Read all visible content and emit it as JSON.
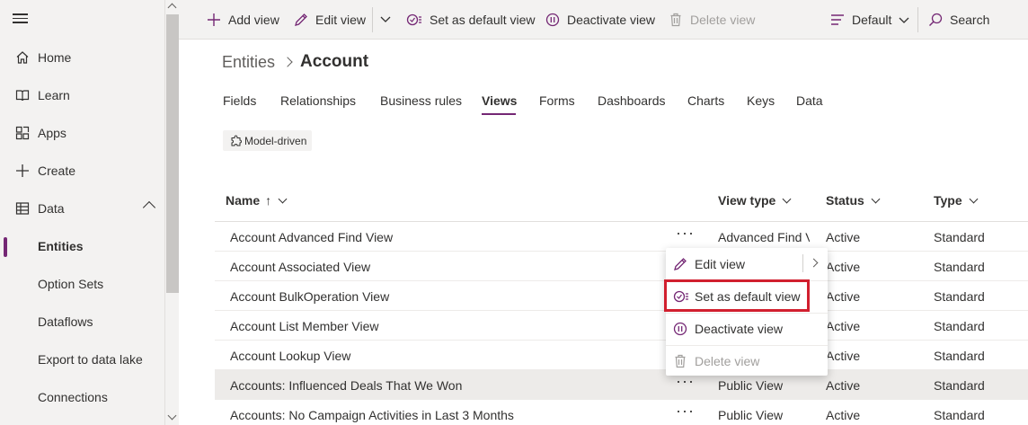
{
  "sidebar": {
    "items": [
      {
        "label": "Home",
        "icon": "home-icon"
      },
      {
        "label": "Learn",
        "icon": "book-icon"
      },
      {
        "label": "Apps",
        "icon": "apps-icon"
      },
      {
        "label": "Create",
        "icon": "plus-icon"
      },
      {
        "label": "Data",
        "icon": "table-icon"
      },
      {
        "label": "Entities"
      },
      {
        "label": "Option Sets"
      },
      {
        "label": "Dataflows"
      },
      {
        "label": "Export to data lake"
      },
      {
        "label": "Connections"
      }
    ]
  },
  "commandbar": {
    "add_view": "Add view",
    "edit_view": "Edit view",
    "set_default": "Set as default view",
    "deactivate": "Deactivate view",
    "delete": "Delete view",
    "filter": "Default",
    "search": "Search"
  },
  "breadcrumb": {
    "parent": "Entities",
    "current": "Account"
  },
  "tabs": [
    "Fields",
    "Relationships",
    "Business rules",
    "Views",
    "Forms",
    "Dashboards",
    "Charts",
    "Keys",
    "Data"
  ],
  "active_tab": "Views",
  "chip": "Model-driven",
  "table": {
    "columns": [
      "Name",
      "View type",
      "Status",
      "Type"
    ],
    "sort_indicator": "↑",
    "rows": [
      {
        "name": "Account Advanced Find View",
        "view_type": "Advanced Find View",
        "status": "Active",
        "type": "Standard"
      },
      {
        "name": "Account Associated View",
        "view_type": "",
        "status": "Active",
        "type": "Standard"
      },
      {
        "name": "Account BulkOperation View",
        "view_type": "",
        "status": "Active",
        "type": "Standard"
      },
      {
        "name": "Account List Member View",
        "view_type": "",
        "status": "Active",
        "type": "Standard"
      },
      {
        "name": "Account Lookup View",
        "view_type": "",
        "status": "Active",
        "type": "Standard"
      },
      {
        "name": "Accounts: Influenced Deals That We Won",
        "view_type": "Public View",
        "status": "Active",
        "type": "Standard"
      },
      {
        "name": "Accounts: No Campaign Activities in Last 3 Months",
        "view_type": "Public View",
        "status": "Active",
        "type": "Standard"
      }
    ],
    "more_label": "···"
  },
  "context_menu": {
    "edit": "Edit view",
    "set_default": "Set as default view",
    "deactivate": "Deactivate view",
    "delete": "Delete view"
  },
  "colors": {
    "accent": "#742774",
    "highlight": "#d11f2e"
  }
}
